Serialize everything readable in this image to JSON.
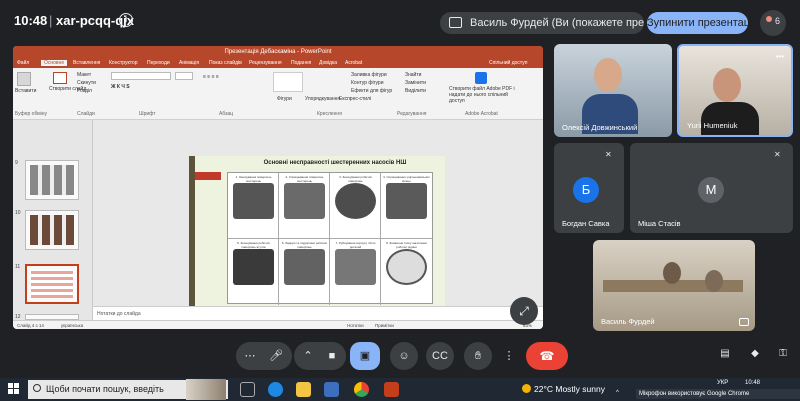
{
  "meet": {
    "time": "10:48",
    "separator": "|",
    "meeting_code": "xar-pcqq-qjx",
    "presenting_label": "Василь Фурдей (Ви (покажете презентацію)",
    "stop_presenting": "Зупинити презентацію",
    "participants_count": "6"
  },
  "powerpoint": {
    "window_title": "Презентація Дебаскаміна - PowerPoint",
    "tabs": [
      "Файл",
      "Основне",
      "Вставлення",
      "Конструктор",
      "Переходи",
      "Анімація",
      "Показ слайдів",
      "Рецензування",
      "Подання",
      "Довідка",
      "Acrobat"
    ],
    "share_label": "Спільний доступ",
    "ribbon_groups": [
      "Буфер обміну",
      "Слайди",
      "Шрифт",
      "Абзац",
      "Креслення",
      "Редагування",
      "Adobe Acrobat"
    ],
    "ribbon_items": [
      "Вставити",
      "Створити слайд",
      "Макет",
      "Скинути",
      "Розділ",
      "Фігури",
      "Упорядкування",
      "Експрес-стилі",
      "Заливка фігури",
      "Контур фігури",
      "Ефекти для фігур",
      "Знайти",
      "Замінити",
      "Виділити",
      "Створити файл Adobe PDF і надати до нього спільний доступ"
    ],
    "slide_numbers": [
      "9",
      "10",
      "11",
      "12"
    ],
    "slide_title": "Основні несправності шестеренних насосів НШ",
    "slide_cells": [
      "1. Зношування поверхонь шестерень",
      "2. Спрацювання поверхонь шестерень",
      "3. Зношування робочих поверхонь",
      "4. Спрацювання ущільнювальних кілець",
      "5. Зношування робочих поверхонь втулок",
      "6. Задири та подряпини робочих поверхонь",
      "7. Руйнування корпусу і його деталей",
      "8. Зниження тиску нагнітання робочої рідини"
    ],
    "notes_placeholder": "Нотатки до слайда",
    "status": {
      "slide_pos": "Слайд 4 з 14",
      "language": "українська",
      "notes": "Нотатки",
      "comments": "Примітки",
      "zoom": "63%"
    }
  },
  "participants": [
    {
      "name": "Олексій Довжинський"
    },
    {
      "name": "Yurii Humeniuk"
    },
    {
      "name": "Богдан Савка",
      "initial": "Б",
      "color": "#1a73e8"
    },
    {
      "name": "Міша Стасів",
      "initial": "М",
      "color": "#5f6368"
    },
    {
      "name": "Василь Фурдей"
    }
  ],
  "taskbar": {
    "search_placeholder": "Щоби почати пошук, введіть",
    "temperature": "22°C",
    "weather": "Mostly sunny",
    "language": "УКР",
    "time": "10:48",
    "notice": "Мікрофон використовує Google Chrome"
  }
}
